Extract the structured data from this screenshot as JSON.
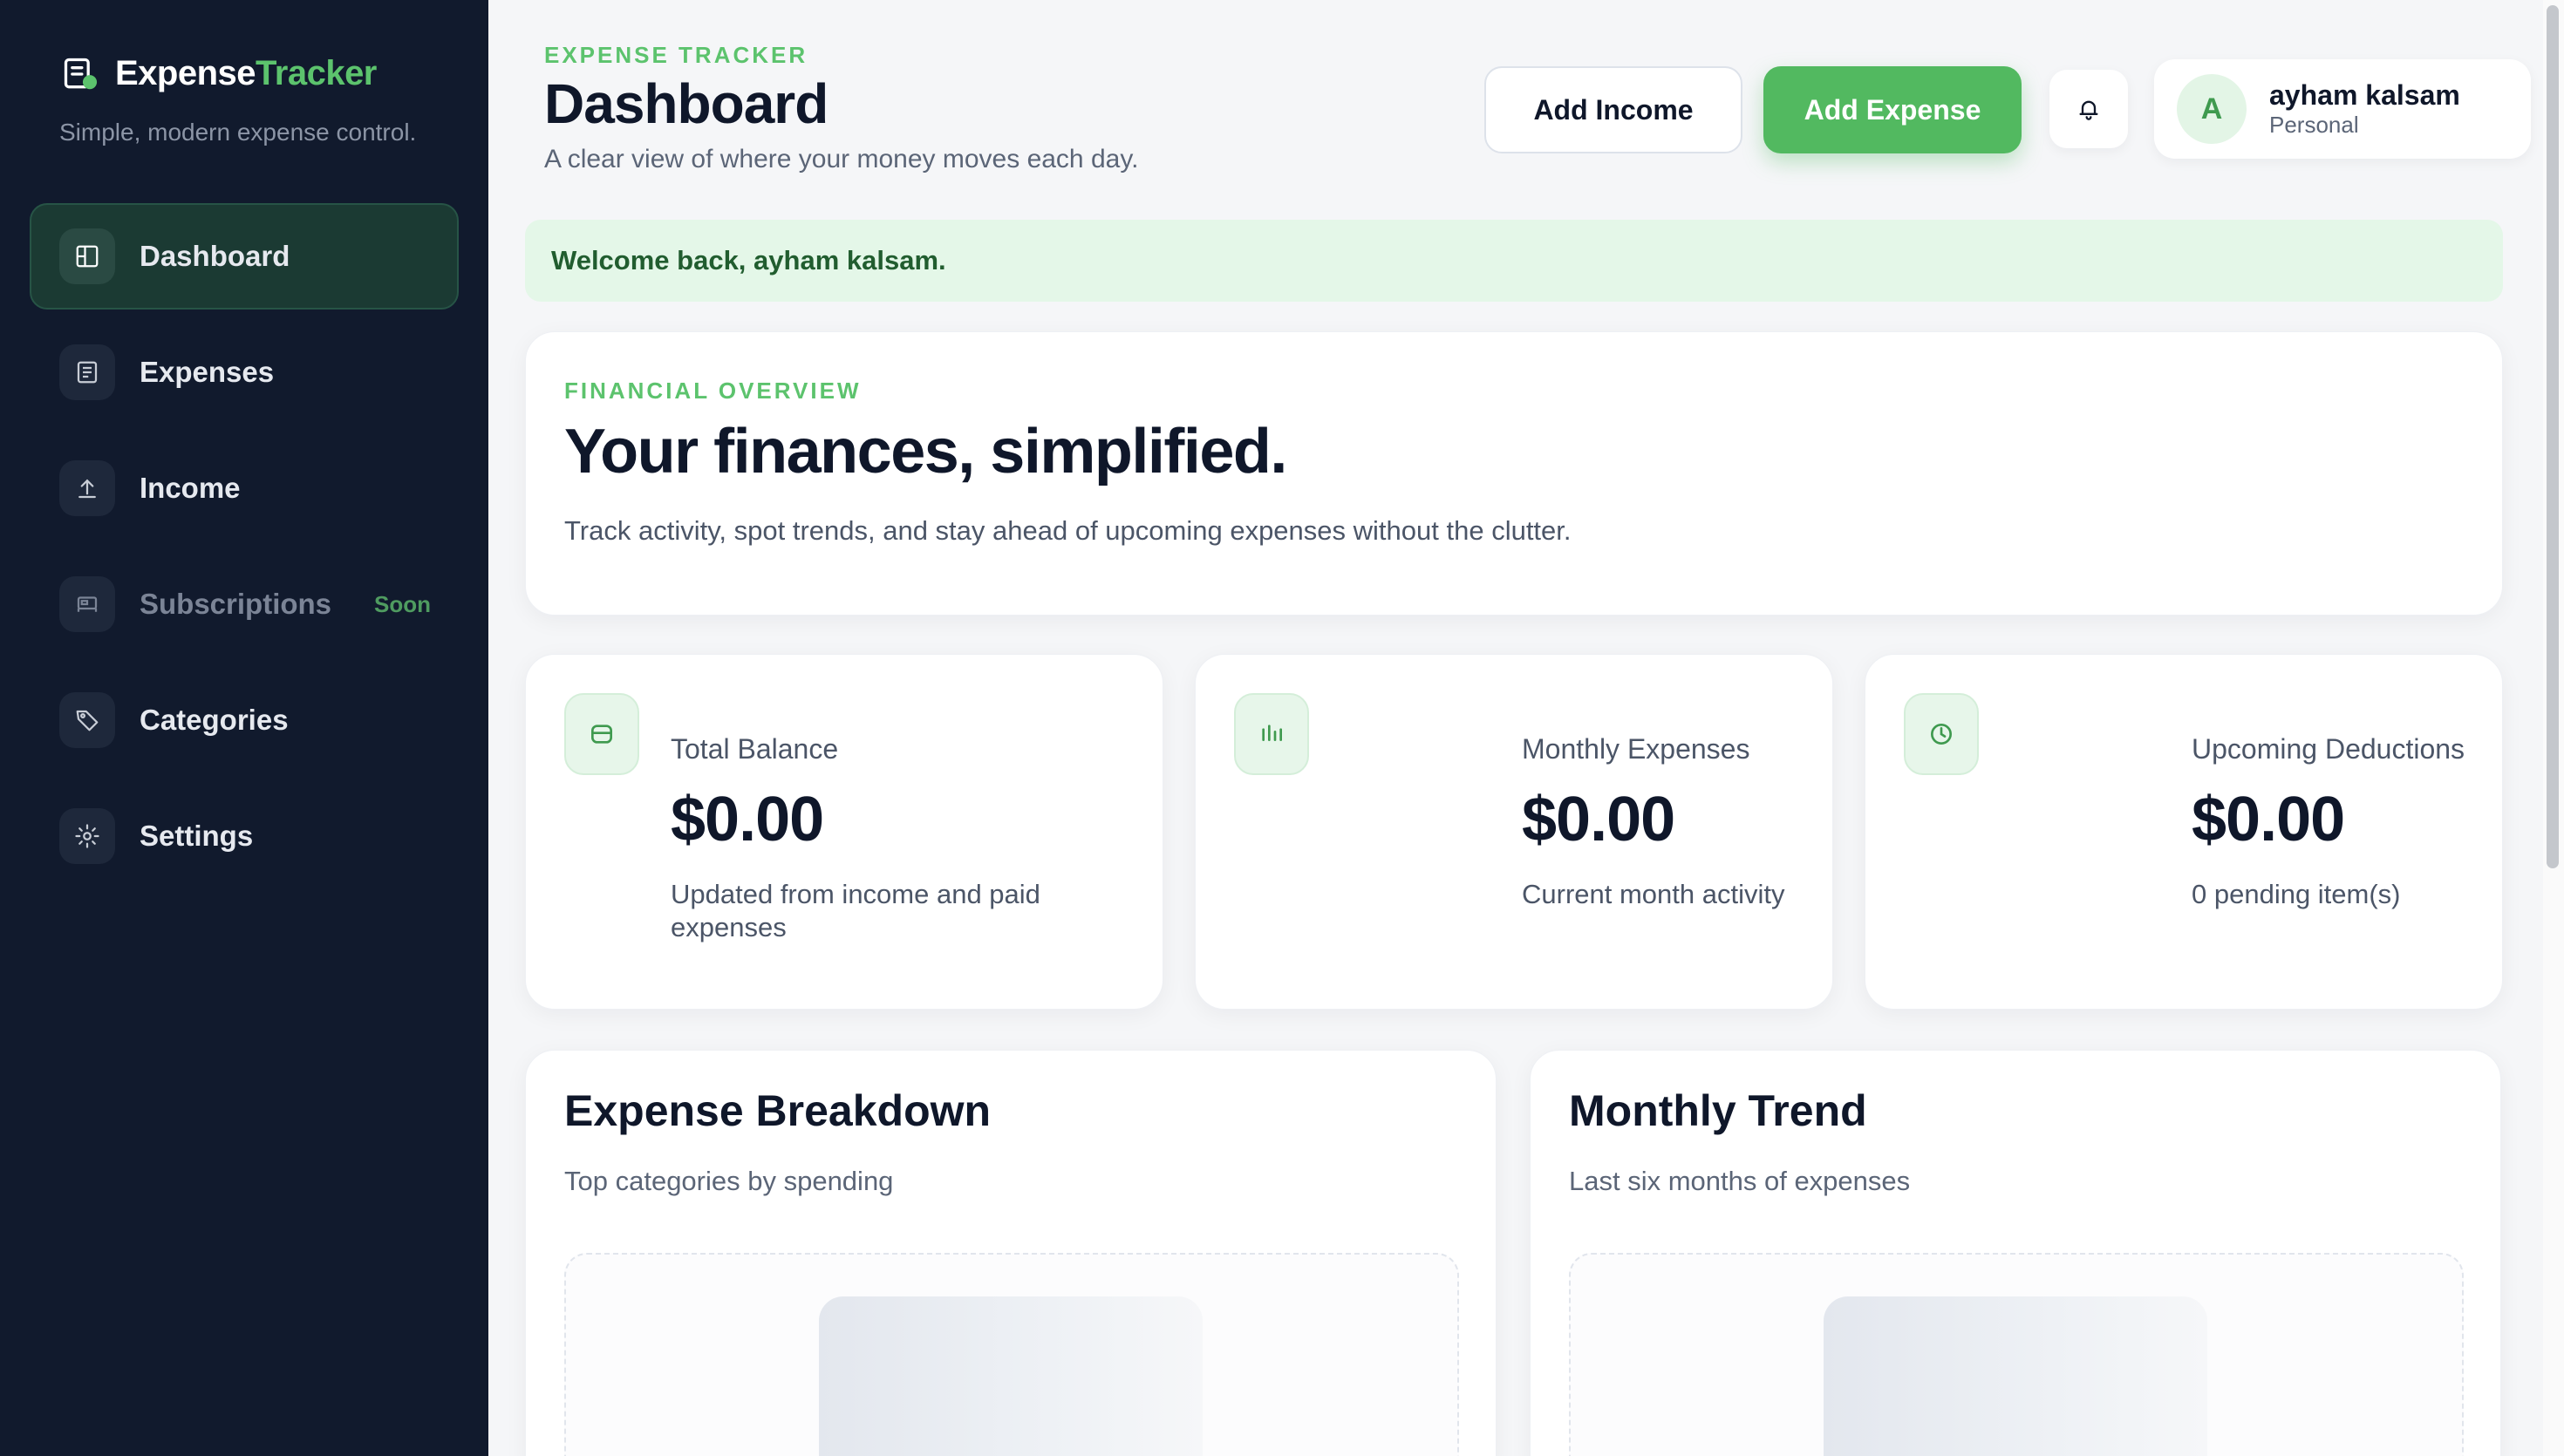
{
  "brand": {
    "name_part1": "Expense",
    "name_part2": "Tracker",
    "tagline": "Simple, modern expense control."
  },
  "sidebar": {
    "items": [
      {
        "label": "Dashboard",
        "icon": "dashboard-icon",
        "active": true
      },
      {
        "label": "Expenses",
        "icon": "receipt-icon"
      },
      {
        "label": "Income",
        "icon": "upload-icon"
      },
      {
        "label": "Subscriptions",
        "icon": "bed-icon",
        "badge": "Soon",
        "muted": true
      },
      {
        "label": "Categories",
        "icon": "tag-icon"
      },
      {
        "label": "Settings",
        "icon": "gear-icon"
      }
    ]
  },
  "header": {
    "eyebrow": "EXPENSE TRACKER",
    "title": "Dashboard",
    "subtitle": "A clear view of where your money moves each day.",
    "add_income_label": "Add Income",
    "add_expense_label": "Add Expense"
  },
  "user": {
    "initial": "A",
    "name": "ayham kalsam",
    "role": "Personal"
  },
  "welcome": "Welcome back, ayham kalsam.",
  "overview": {
    "eyebrow": "FINANCIAL OVERVIEW",
    "headline": "Your finances, simplified.",
    "text": "Track activity, spot trends, and stay ahead of upcoming expenses without the clutter."
  },
  "stats": [
    {
      "label": "Total Balance",
      "value": "$0.00",
      "note": "Updated from income and paid expenses",
      "icon": "wallet-icon"
    },
    {
      "label": "Monthly Expenses",
      "value": "$0.00",
      "note": "Current month activity",
      "icon": "bar-chart-icon"
    },
    {
      "label": "Upcoming Deductions",
      "value": "$0.00",
      "note": "0 pending item(s)",
      "icon": "clock-icon"
    }
  ],
  "panels": [
    {
      "title": "Expense Breakdown",
      "subtitle": "Top categories by spending"
    },
    {
      "title": "Monthly Trend",
      "subtitle": "Last six months of expenses"
    }
  ],
  "colors": {
    "accent": "#5cc36d",
    "sidebar_bg": "#111a2d",
    "active_bg": "#1b3a33",
    "welcome_bg": "#e4f7e8"
  }
}
